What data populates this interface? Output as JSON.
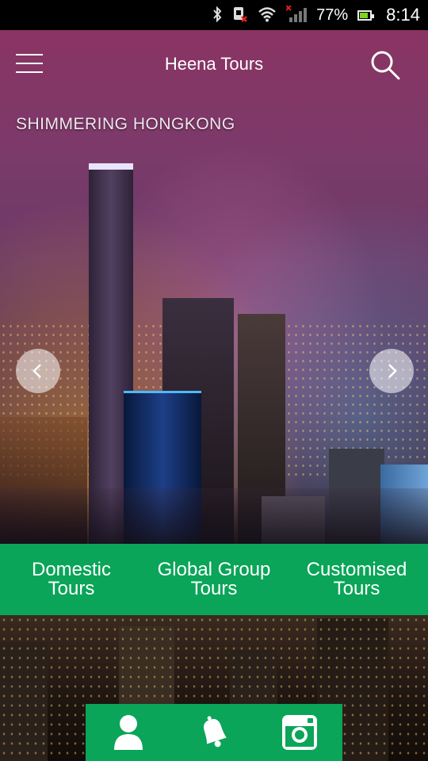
{
  "status_bar": {
    "battery_percent": "77%",
    "time": "8:14",
    "icons": [
      "bluetooth-icon",
      "sim-error-icon",
      "wifi-icon",
      "signal-icon",
      "battery-icon"
    ]
  },
  "app_bar": {
    "title": "Heena Tours",
    "menu_icon": "hamburger-menu-icon",
    "search_icon": "search-icon"
  },
  "hero": {
    "caption": "SHIMMERING HONGKONG",
    "prev_icon": "chevron-left-icon",
    "next_icon": "chevron-right-icon"
  },
  "categories": [
    {
      "line1": "Domestic",
      "line2": "Tours"
    },
    {
      "line1": "Global Group",
      "line2": "Tours"
    },
    {
      "line1": "Customised",
      "line2": "Tours"
    }
  ],
  "actions": [
    {
      "icon": "user-icon"
    },
    {
      "icon": "bell-icon"
    },
    {
      "icon": "instagram-icon"
    }
  ],
  "colors": {
    "brand_green": "#0aa558",
    "status_bar": "#000000"
  }
}
